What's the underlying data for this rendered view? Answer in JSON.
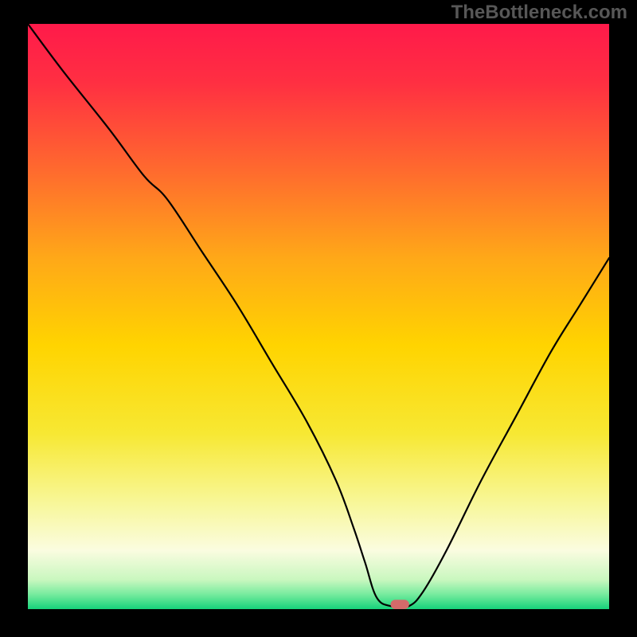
{
  "watermark": "TheBottleneck.com",
  "chart_data": {
    "type": "line",
    "title": "",
    "xlabel": "",
    "ylabel": "",
    "xlim": [
      0,
      100
    ],
    "ylim": [
      0,
      100
    ],
    "background_gradient": {
      "stops": [
        {
          "offset": 0.0,
          "color": "#ff1a4a"
        },
        {
          "offset": 0.1,
          "color": "#ff2f42"
        },
        {
          "offset": 0.25,
          "color": "#ff6a2e"
        },
        {
          "offset": 0.4,
          "color": "#ffa818"
        },
        {
          "offset": 0.55,
          "color": "#ffd400"
        },
        {
          "offset": 0.7,
          "color": "#f7e833"
        },
        {
          "offset": 0.82,
          "color": "#f8f79a"
        },
        {
          "offset": 0.9,
          "color": "#fafce0"
        },
        {
          "offset": 0.95,
          "color": "#c9f7bf"
        },
        {
          "offset": 0.975,
          "color": "#76eb9e"
        },
        {
          "offset": 1.0,
          "color": "#16d27a"
        }
      ]
    },
    "series": [
      {
        "name": "bottleneck-curve",
        "color": "#000000",
        "x": [
          0.0,
          6.0,
          14.0,
          20.0,
          24.0,
          30.0,
          36.0,
          42.0,
          48.0,
          53.0,
          56.0,
          58.0,
          60.0,
          62.5,
          65.5,
          68.0,
          72.0,
          78.0,
          84.0,
          90.0,
          95.0,
          100.0
        ],
        "y": [
          100.0,
          92.0,
          82.0,
          74.0,
          70.0,
          61.0,
          52.0,
          42.0,
          32.0,
          22.0,
          14.0,
          8.0,
          2.0,
          0.5,
          0.5,
          3.0,
          10.0,
          22.0,
          33.0,
          44.0,
          52.0,
          60.0
        ]
      }
    ],
    "marker": {
      "name": "optimal-point",
      "x": 64.0,
      "y": 0.8,
      "color": "#d46a6a",
      "width": 3.2,
      "height": 1.6
    }
  }
}
